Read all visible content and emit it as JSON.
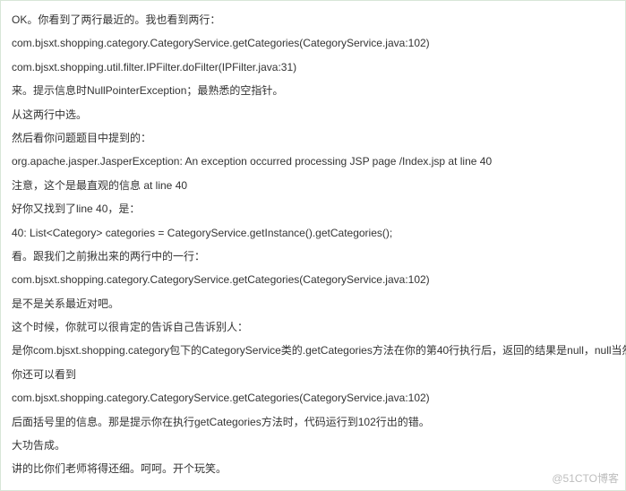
{
  "lines": [
    "OK。你看到了两行最近的。我也看到两行：",
    "com.bjsxt.shopping.category.CategoryService.getCategories(CategoryService.java:102)",
    "com.bjsxt.shopping.util.filter.IPFilter.doFilter(IPFilter.java:31)",
    "来。提示信息时NullPointerException；最熟悉的空指针。",
    "从这两行中选。",
    "然后看你问题题目中提到的：",
    "org.apache.jasper.JasperException: An exception occurred processing JSP page /Index.jsp at line 40",
    "注意，这个是最直观的信息  at line 40",
    "好你又找到了line 40，是：",
    "40: List<Category> categories = CategoryService.getInstance().getCategories();",
    "看。跟我们之前揪出来的两行中的一行：",
    "com.bjsxt.shopping.category.CategoryService.getCategories(CategoryService.java:102)",
    "是不是关系最近对吧。",
    "这个时候，你就可以很肯定的告诉自己告诉别人：",
    "是你com.bjsxt.shopping.category包下的CategoryService类的.getCategories方法在你的第40行执行后，返回的结果是null，null当然就报nullpointException了。",
    "你还可以看到",
    "com.bjsxt.shopping.category.CategoryService.getCategories(CategoryService.java:102)",
    "后面括号里的信息。那是提示你在执行getCategories方法时，代码运行到102行出的错。",
    "大功告成。",
    "讲的比你们老师将得还细。呵呵。开个玩笑。"
  ],
  "watermark": "@51CTO博客"
}
